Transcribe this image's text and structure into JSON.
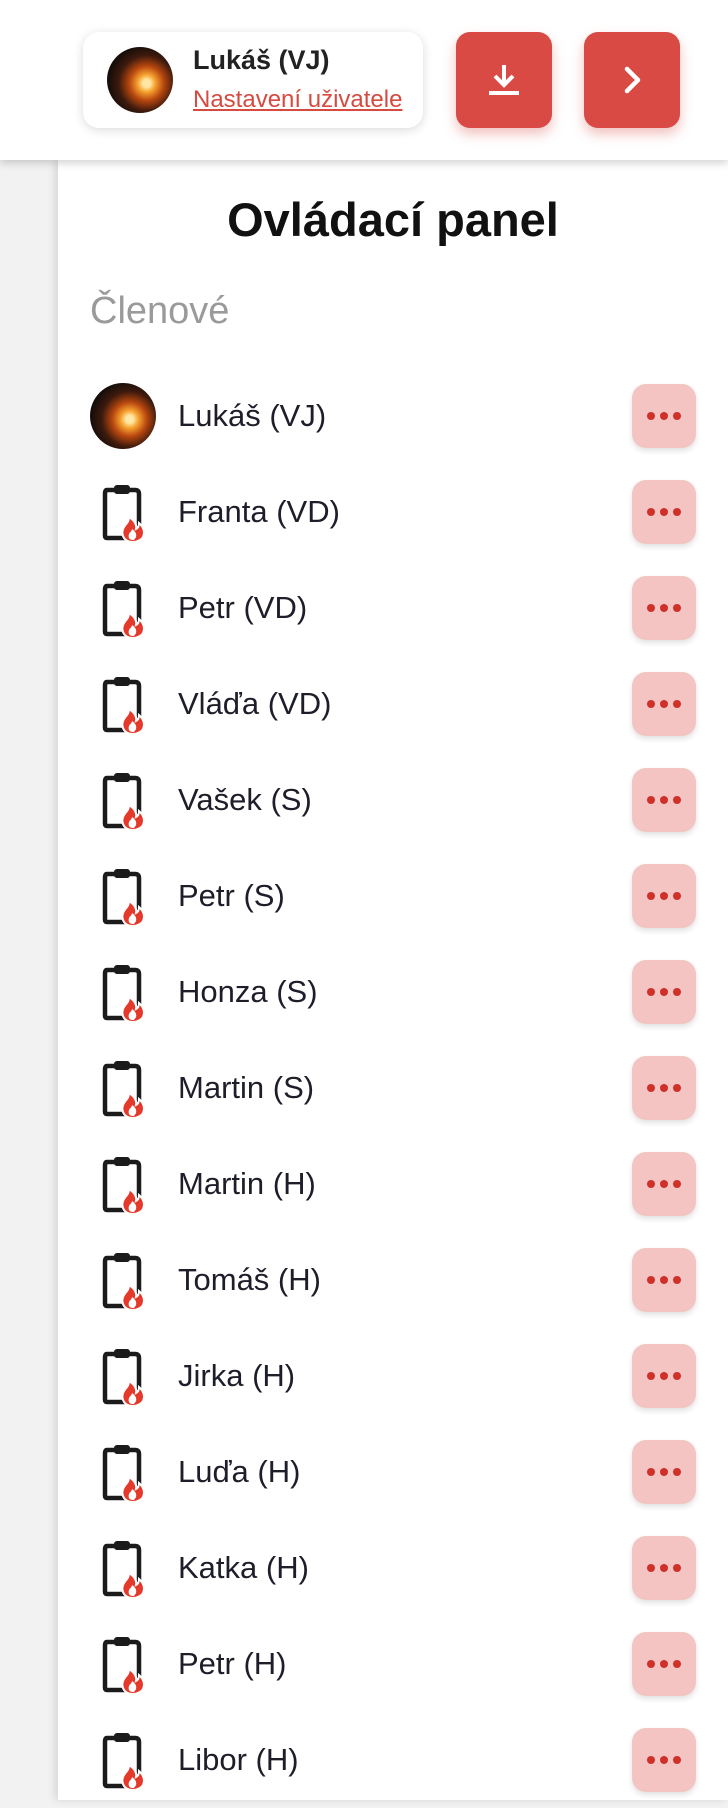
{
  "header": {
    "user_name": "Lukáš (VJ)",
    "user_settings_link": "Nastavení uživatele",
    "download_icon": "download-icon",
    "next_icon": "chevron-right-icon"
  },
  "panel": {
    "title": "Ovládací panel",
    "members_heading": "Členové"
  },
  "members": [
    {
      "name": "Lukáš (VJ)",
      "icon": "avatar"
    },
    {
      "name": "Franta (VD)",
      "icon": "clipboard-fire-icon"
    },
    {
      "name": "Petr (VD)",
      "icon": "clipboard-fire-icon"
    },
    {
      "name": "Vláďa (VD)",
      "icon": "clipboard-fire-icon"
    },
    {
      "name": "Vašek (S)",
      "icon": "clipboard-fire-icon"
    },
    {
      "name": "Petr (S)",
      "icon": "clipboard-fire-icon"
    },
    {
      "name": "Honza (S)",
      "icon": "clipboard-fire-icon"
    },
    {
      "name": "Martin (S)",
      "icon": "clipboard-fire-icon"
    },
    {
      "name": "Martin (H)",
      "icon": "clipboard-fire-icon"
    },
    {
      "name": "Tomáš (H)",
      "icon": "clipboard-fire-icon"
    },
    {
      "name": "Jirka (H)",
      "icon": "clipboard-fire-icon"
    },
    {
      "name": "Luďa (H)",
      "icon": "clipboard-fire-icon"
    },
    {
      "name": "Katka (H)",
      "icon": "clipboard-fire-icon"
    },
    {
      "name": "Petr (H)",
      "icon": "clipboard-fire-icon"
    },
    {
      "name": "Libor (H)",
      "icon": "clipboard-fire-icon"
    }
  ],
  "colors": {
    "accent": "#d84a43",
    "more_button_bg": "#f4c4c2",
    "link": "#d64a40"
  }
}
